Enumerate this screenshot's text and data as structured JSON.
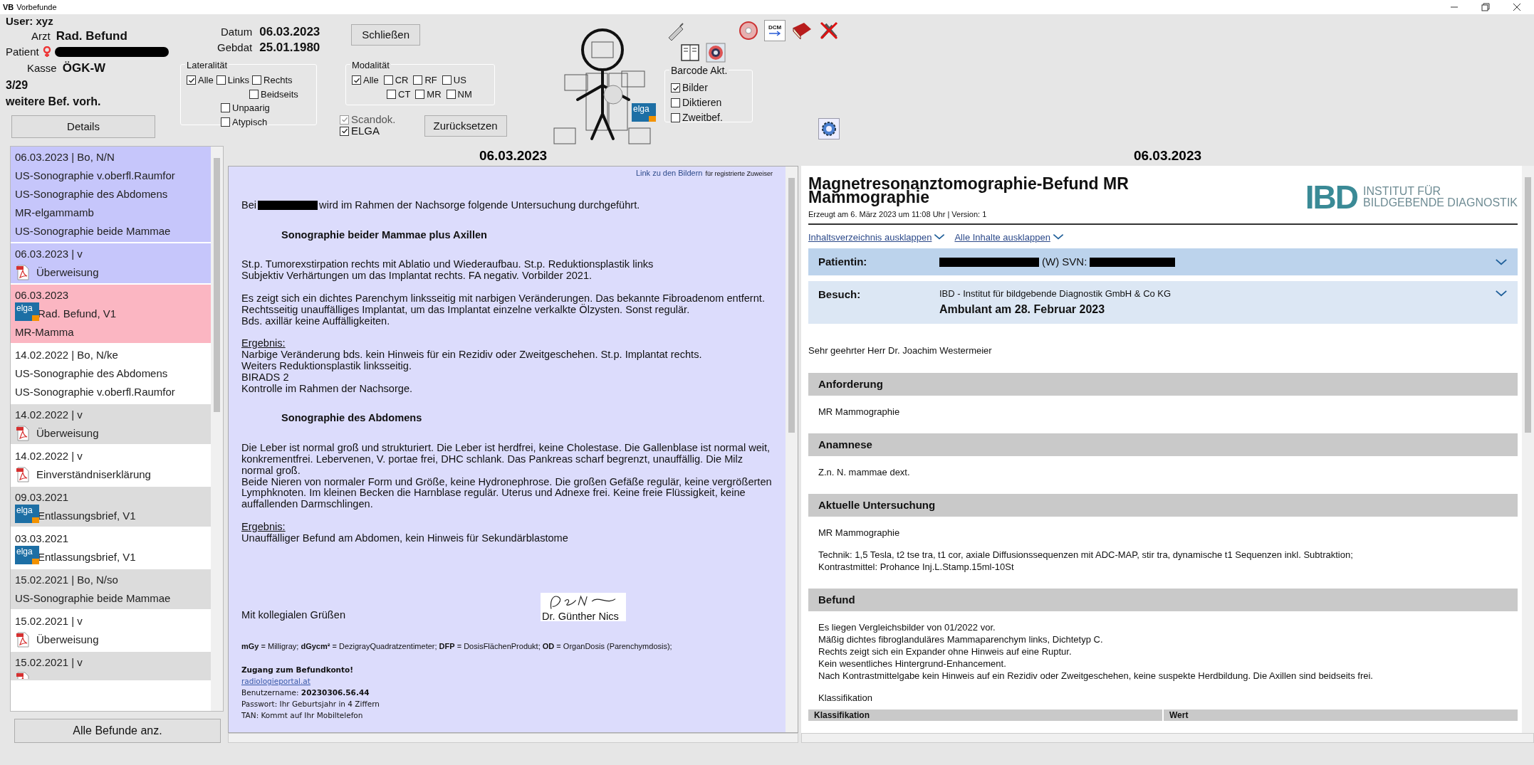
{
  "window": {
    "badge": "VB",
    "title": "Vorbefunde"
  },
  "header": {
    "user": "User: xyz",
    "arzt_label": "Arzt",
    "arzt_value": "Rad. Befund",
    "patient_label": "Patient",
    "kasse_label": "Kasse",
    "kasse_value": "ÖGK-W",
    "count": "3/29",
    "more": "weitere Bef. vorh.",
    "details_button": "Details",
    "datum_label": "Datum",
    "datum_value": "06.03.2023",
    "gebdat_label": "Gebdat",
    "gebdat_value": "25.01.1980",
    "close_button": "Schließen",
    "reset_button": "Zurücksetzen",
    "elga_logo": "elga",
    "dcm_label": "DCM",
    "lateralitaet": {
      "title": "Lateralität",
      "options": [
        {
          "label": "Alle",
          "checked": true
        },
        {
          "label": "Links",
          "checked": false
        },
        {
          "label": "Rechts",
          "checked": false
        },
        {
          "label": "Beidseits",
          "checked": false
        },
        {
          "label": "Unpaarig",
          "checked": false
        },
        {
          "label": "Atypisch",
          "checked": false
        }
      ]
    },
    "modalitaet": {
      "title": "Modalität",
      "options": [
        {
          "label": "Alle",
          "checked": true
        },
        {
          "label": "CR",
          "checked": false
        },
        {
          "label": "RF",
          "checked": false
        },
        {
          "label": "US",
          "checked": false
        },
        {
          "label": "CT",
          "checked": false
        },
        {
          "label": "MR",
          "checked": false
        },
        {
          "label": "NM",
          "checked": false
        }
      ]
    },
    "sources": [
      {
        "label": "Scandok.",
        "checked": true,
        "disabled": true
      },
      {
        "label": "ELGA",
        "checked": true,
        "disabled": false
      }
    ],
    "barcode": {
      "title": "Barcode Akt.",
      "options": [
        {
          "label": "Bilder",
          "checked": true
        },
        {
          "label": "Diktieren",
          "checked": false
        },
        {
          "label": "Zweitbef.",
          "checked": false
        }
      ]
    }
  },
  "list": {
    "items": [
      {
        "title": "06.03.2023 | Bo, N/N",
        "kind": "plain",
        "color": "#c6c6fb",
        "lines": [
          "US-Sonographie v.oberfl.Raumfor",
          "US-Sonographie des Abdomens",
          "MR-elgammamb",
          "US-Sonographie beide Mammae"
        ]
      },
      {
        "title": "06.03.2023 | v",
        "kind": "pdf",
        "color": "#c6c6fb",
        "lines": [
          "Überweisung"
        ]
      },
      {
        "title": "06.03.2023",
        "kind": "elga",
        "logo": "elga",
        "color": "#fbb6c2",
        "lines": [
          "Rad. Befund, V1",
          "MR-Mamma"
        ]
      },
      {
        "title": "14.02.2022 | Bo, N/ke",
        "kind": "plain",
        "color": "#ffffff",
        "lines": [
          "US-Sonographie des Abdomens",
          "US-Sonographie v.oberfl.Raumfor"
        ]
      },
      {
        "title": "14.02.2022 | v",
        "kind": "pdf",
        "color": "#dcdcdc",
        "lines": [
          "Überweisung"
        ]
      },
      {
        "title": "14.02.2022 | v",
        "kind": "pdf",
        "color": "#ffffff",
        "lines": [
          "Einverständniserklärung"
        ]
      },
      {
        "title": "09.03.2021",
        "kind": "elga",
        "logo": "elga",
        "color": "#dcdcdc",
        "lines": [
          "Entlassungsbrief, V1"
        ]
      },
      {
        "title": "03.03.2021",
        "kind": "elga",
        "logo": "elga",
        "color": "#ffffff",
        "lines": [
          "Entlassungsbrief, V1"
        ]
      },
      {
        "title": "15.02.2021 | Bo, N/so",
        "kind": "plain",
        "color": "#dcdcdc",
        "lines": [
          "US-Sonographie beide Mammae"
        ]
      },
      {
        "title": "15.02.2021 | v",
        "kind": "pdf",
        "color": "#ffffff",
        "lines": [
          "Überweisung"
        ]
      },
      {
        "title": "15.02.2021 | v",
        "kind": "pdf",
        "color": "#dcdcdc"
      }
    ],
    "all_button": "Alle Befunde anz."
  },
  "middle_doc": {
    "heading": "06.03.2023",
    "link": "Link zu den Bildern",
    "link_note": "für registrierte Zuweiser",
    "intro_before": "Bei",
    "intro_after": "wird im Rahmen der Nachsorge folgende Untersuchung durchgeführt.",
    "blocks": [
      {
        "kind": "heading",
        "text": "Sonographie beider Mammae plus Axillen"
      },
      {
        "kind": "para",
        "lines": [
          "St.p. Tumorexstirpation rechts mit Ablatio und Wiederaufbau. St.p. Reduktionsplastik links",
          "Subjektiv Verhärtungen um das Implantat rechts. FA negativ. Vorbilder 2021."
        ]
      },
      {
        "kind": "para",
        "lines": [
          "Es zeigt sich ein dichtes Parenchym linksseitig mit narbigen Veränderungen. Das bekannte Fibroadenom entfernt.",
          "Rechtsseitig unauffälliges Implantat, um das Implantat einzelne verkalkte Ölzysten. Sonst regulär.",
          "Bds. axillär keine Auffälligkeiten."
        ]
      },
      {
        "kind": "result",
        "label": "Ergebnis:",
        "lines": [
          "Narbige Veränderung bds. kein Hinweis für ein Rezidiv oder Zweitgeschehen. St.p. Implantat rechts.",
          "Weiters Reduktionsplastik linksseitig.",
          "BIRADS 2",
          "Kontrolle im Rahmen der Nachsorge."
        ]
      },
      {
        "kind": "heading",
        "text": "Sonographie des Abdomens"
      },
      {
        "kind": "para",
        "lines": [
          "Die Leber ist normal groß und strukturiert. Die Leber ist herdfrei, keine Cholestase. Die Gallenblase ist normal weit, konkrementfrei. Lebervenen, V. portae frei, DHC schlank. Das Pankreas scharf begrenzt, unauffällig. Die Milz normal groß.",
          "Beide Nieren von normaler Form und Größe, keine Hydronephrose. Die großen Gefäße regulär, keine vergrößerten Lymphknoten. Im kleinen Becken die Harnblase regulär. Uterus und Adnexe frei. Keine freie Flüssigkeit, keine auffallenden Darmschlingen."
        ]
      },
      {
        "kind": "result",
        "label": "Ergebnis:",
        "lines": [
          "Unauffälliger Befund am Abdomen, kein Hinweis für Sekundärblastome"
        ]
      }
    ],
    "closing": "Mit kollegialen Grüßen",
    "signer": "Dr. Günther Nics",
    "abbreviations": "**mGy** = Milligray; **dGycm²** = DezigrayQuadratzentimeter; **DFP** = DosisFlächenProdukt; **OD** = OrganDosis (Parenchymdosis);",
    "access_title": "Zugang zum Befundkonto!",
    "access_link": "radiologieportal.at",
    "access_lines": [
      "Benutzername: **20230306.56.44**",
      "Passwort: Ihr Geburtsjahr in 4 Ziffern",
      "TAN: Kommt auf Ihr Mobiltelefon"
    ]
  },
  "right_doc": {
    "heading": "06.03.2023",
    "title": "Magnetresonanztomographie-Befund MR Mammographie",
    "meta": "Erzeugt am 6. März 2023 um 11:08 Uhr | Version: 1",
    "logo_mark": "IBD",
    "logo_lines": [
      "INSTITUT FÜR",
      "BILDGEBENDE DIAGNOSTIK"
    ],
    "links": [
      "Inhaltsverzeichnis ausklappen",
      "Alle Inhalte ausklappen"
    ],
    "patient_label": "Patientin:",
    "patient_mid": "(W) SVN:",
    "visit_label": "Besuch:",
    "visit_place": "IBD - Institut für bildgebende Diagnostik GmbH & Co KG",
    "visit_date": "Ambulant am 28. Februar 2023",
    "salutation": "Sehr geehrter Herr Dr. Joachim Westermeier",
    "sections": [
      {
        "title": "Anforderung",
        "paragraphs": [
          [
            "MR Mammographie"
          ]
        ]
      },
      {
        "title": "Anamnese",
        "paragraphs": [
          [
            "Z.n. N. mammae dext."
          ]
        ]
      },
      {
        "title": "Aktuelle Untersuchung",
        "paragraphs": [
          [
            "MR Mammographie"
          ],
          [
            "Technik: 1,5 Tesla, t2 tse tra, t1 cor, axiale Diffusionssequenzen mit ADC-MAP, stir tra, dynamische t1 Sequenzen inkl. Subtraktion;",
            "Kontrastmittel: Prohance Inj.L.Stamp.15ml-10St"
          ]
        ]
      },
      {
        "title": "Befund",
        "paragraphs": [
          [
            "Es liegen Vergleichsbilder von 01/2022 vor.",
            "Mäßig dichtes fibroglanduläres Mammaparenchym links, Dichtetyp C.",
            "Rechts zeigt sich ein Expander ohne Hinweis auf eine Ruptur.",
            "Kein wesentliches Hintergrund-Enhancement.",
            "Nach Kontrastmittelgabe kein Hinweis auf ein Rezidiv oder Zweitgeschehen, keine suspekte Herdbildung. Die Axillen sind beidseits frei."
          ],
          [
            "Klassifikation"
          ]
        ]
      }
    ],
    "table_columns": [
      "Klassifikation",
      "Wert"
    ]
  }
}
